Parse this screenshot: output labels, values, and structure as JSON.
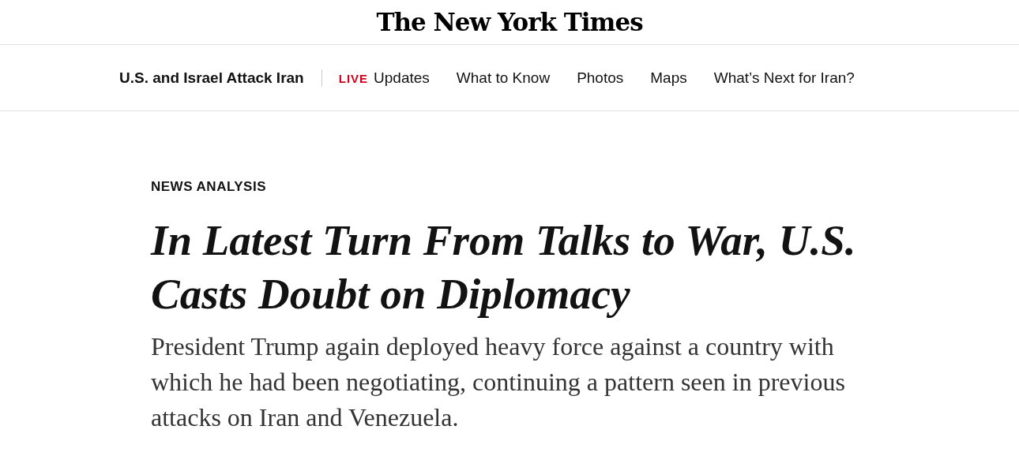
{
  "masthead": {
    "logo": "The New York Times"
  },
  "nav": {
    "section": "U.S. and Israel Attack Iran",
    "links": [
      {
        "badge": "LIVE",
        "label": "Updates"
      },
      {
        "label": "What to Know"
      },
      {
        "label": "Photos"
      },
      {
        "label": "Maps"
      },
      {
        "label": "What’s Next for Iran?"
      }
    ]
  },
  "article": {
    "kicker": "NEWS ANALYSIS",
    "headline": "In Latest Turn From Talks to War, U.S. Casts Doubt on Diplomacy",
    "summary": "President Trump again deployed heavy force against a country with which he had been negotiating, continuing a pattern seen in previous attacks on Iran and Venezuela."
  }
}
